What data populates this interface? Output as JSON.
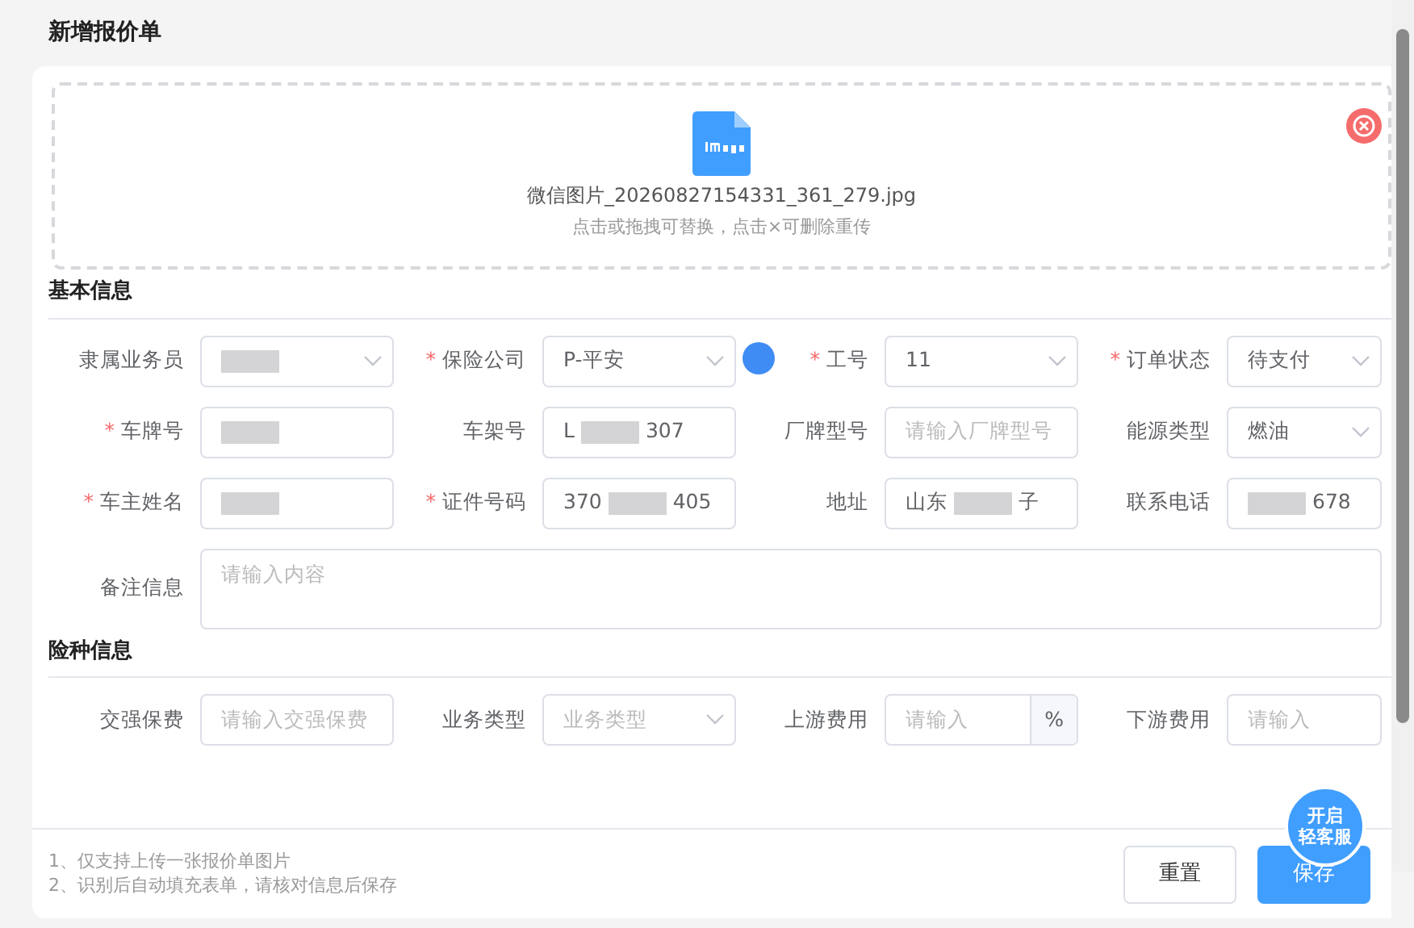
{
  "title": "新增报价单",
  "upload": {
    "file_name": "微信图片_20260827154331_361_279.jpg",
    "hint": "点击或拖拽可替换，点击×可删除重传"
  },
  "required_mark": "*",
  "sections": [
    {
      "title": "基本信息",
      "fields": [
        {
          "label": "隶属业务员",
          "required": false,
          "kind": "select",
          "blurred": true
        },
        {
          "label": "保险公司",
          "required": true,
          "kind": "select",
          "value": "P-平安"
        },
        {
          "label": "工号",
          "required": true,
          "kind": "select",
          "value": "11"
        },
        {
          "label": "订单状态",
          "required": true,
          "kind": "select",
          "value": "待支付"
        },
        {
          "label": "车牌号",
          "required": true,
          "kind": "input",
          "blurred": true
        },
        {
          "label": "车架号",
          "required": false,
          "kind": "input",
          "value": "L",
          "value_end": "307",
          "blurred": true
        },
        {
          "label": "厂牌型号",
          "required": false,
          "kind": "input",
          "placeholder": "请输入厂牌型号"
        },
        {
          "label": "能源类型",
          "required": false,
          "kind": "select",
          "value": "燃油"
        },
        {
          "label": "车主姓名",
          "required": true,
          "kind": "input",
          "blurred": true
        },
        {
          "label": "证件号码",
          "required": true,
          "kind": "input",
          "value": "370",
          "value_end": "405",
          "blurred": true
        },
        {
          "label": "地址",
          "required": false,
          "kind": "input",
          "value": "山东",
          "value_end": "子",
          "blurred": true
        },
        {
          "label": "联系电话",
          "required": false,
          "kind": "input",
          "value_end": "678",
          "blurred": true
        },
        {
          "label": "备注信息",
          "required": false,
          "kind": "textarea",
          "placeholder": "请输入内容"
        }
      ]
    },
    {
      "title": "险种信息",
      "fields": [
        {
          "label": "交强保费",
          "required": false,
          "kind": "input",
          "placeholder": "请输入交强保费"
        },
        {
          "label": "业务类型",
          "required": false,
          "kind": "select",
          "placeholder": "业务类型"
        },
        {
          "label": "上游费用",
          "required": false,
          "kind": "input",
          "placeholder": "请输入",
          "suffix": "%"
        },
        {
          "label": "下游费用",
          "required": false,
          "kind": "input",
          "placeholder": "请输入"
        }
      ]
    }
  ],
  "notes": [
    "1、仅支持上传一张报价单图片",
    "2、识别后自动填充表单，请核对信息后保存"
  ],
  "buttons": [
    {
      "label": "重置",
      "kind": "default"
    },
    {
      "label": "保存",
      "kind": "primary"
    }
  ],
  "float_button": {
    "lines": [
      "开启",
      "轻客服"
    ]
  }
}
